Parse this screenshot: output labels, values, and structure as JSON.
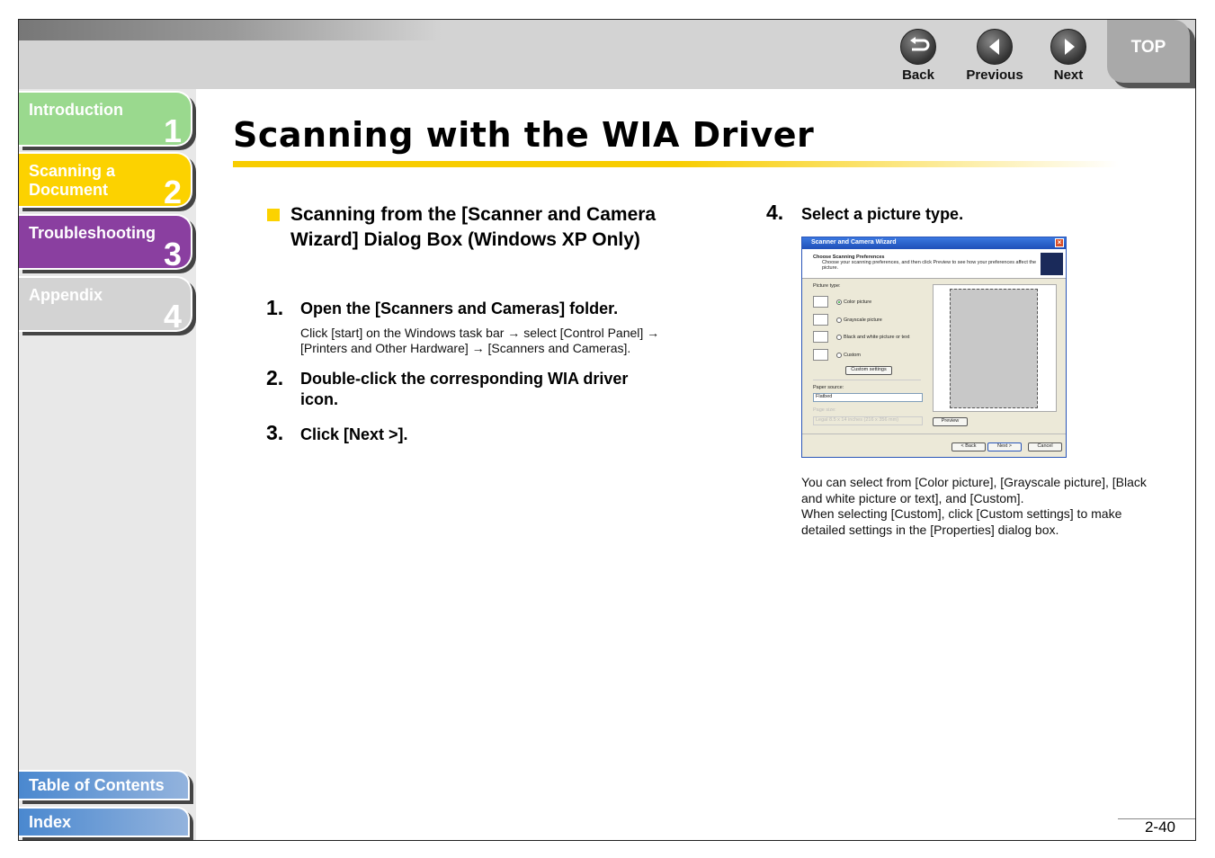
{
  "nav": {
    "back": "Back",
    "previous": "Previous",
    "next": "Next",
    "top": "TOP"
  },
  "sidebar": {
    "tabs": [
      {
        "label": "Introduction",
        "number": "1",
        "color": "#9ad98e"
      },
      {
        "label": "Scanning a Document",
        "number": "2",
        "color": "#fcd200"
      },
      {
        "label": "Troubleshooting",
        "number": "3",
        "color": "#8a3fa0"
      },
      {
        "label": "Appendix",
        "number": "4",
        "color": "#d3d3d3"
      }
    ],
    "toc": "Table of Contents",
    "index": "Index"
  },
  "page": {
    "title": "Scanning with the WIA Driver",
    "section_title": "Scanning from the [Scanner and Camera Wizard] Dialog Box (Windows XP Only)",
    "steps": [
      {
        "num": "1.",
        "title": "Open the [Scanners and Cameras] folder.",
        "body_line1": "Click [start] on the Windows task bar → select [Control Panel] →",
        "body_line2": "[Printers and Other Hardware] → [Scanners and Cameras]."
      },
      {
        "num": "2.",
        "title": "Double-click the corresponding WIA driver icon."
      },
      {
        "num": "3.",
        "title": "Click [Next >]."
      },
      {
        "num": "4.",
        "title": "Select a picture type."
      }
    ],
    "note_line1": "You can select from [Color picture], [Grayscale picture], [Black",
    "note_line2": "and white picture or text], and [Custom].",
    "note_line3": "When selecting [Custom], click [Custom settings] to make",
    "note_line4": "detailed settings in the [Properties] dialog box.",
    "page_number": "2-40"
  },
  "dialog": {
    "title": "Scanner and Camera Wizard",
    "heading": "Choose Scanning Preferences",
    "subheading": "Choose your scanning preferences, and then click Preview to see how your preferences affect the picture.",
    "picture_type_label": "Picture type:",
    "options": [
      "Color picture",
      "Grayscale picture",
      "Black and white picture or text",
      "Custom"
    ],
    "selected_option": "Color picture",
    "custom_settings": "Custom settings",
    "paper_source_label": "Paper source:",
    "paper_source": "Flatbed",
    "page_size_label": "Page size:",
    "page_size": "Legal 8.5 x 14 inches (216 x 356 mm)",
    "preview": "Preview",
    "back": "< Back",
    "next": "Next >",
    "cancel": "Cancel"
  }
}
